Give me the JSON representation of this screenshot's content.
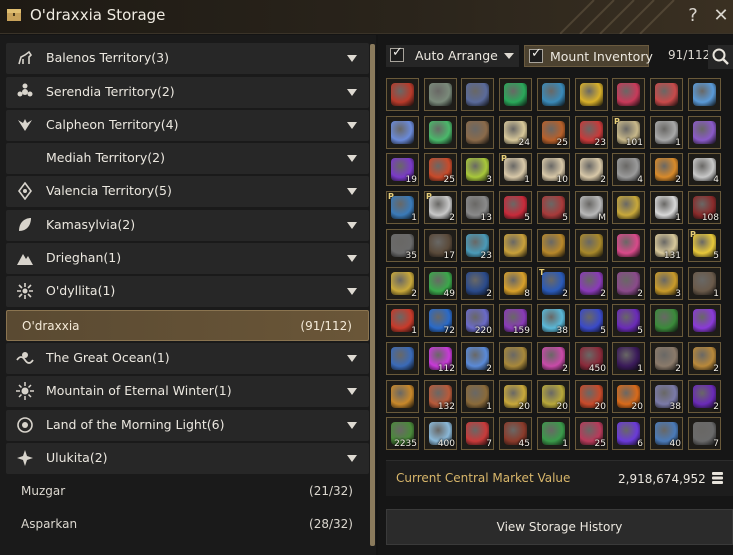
{
  "window": {
    "title": "O'draxxia Storage"
  },
  "regions": [
    {
      "label": "Balenos Territory(3)",
      "icon": "horse-icon"
    },
    {
      "label": "Serendia Territory(2)",
      "icon": "flower-icon"
    },
    {
      "label": "Calpheon Territory(4)",
      "icon": "wings-icon"
    },
    {
      "label": "Mediah Territory(2)",
      "icon": "crescent-icon"
    },
    {
      "label": "Valencia Territory(5)",
      "icon": "gem-icon"
    },
    {
      "label": "Kamasylvia(2)",
      "icon": "leaf-icon"
    },
    {
      "label": "Drieghan(1)",
      "icon": "mountain-icon"
    },
    {
      "label": "O'dyllita(1)",
      "icon": "blossom-icon"
    }
  ],
  "selected_storage": {
    "label": "O'draxxia",
    "count": "(91/112)"
  },
  "regions_after": [
    {
      "label": "The Great Ocean(1)",
      "icon": "wave-icon"
    },
    {
      "label": "Mountain of Eternal Winter(1)",
      "icon": "sun-icon"
    },
    {
      "label": "Land of the Morning Light(6)",
      "icon": "compass-icon"
    },
    {
      "label": "Ulukita(2)",
      "icon": "star-icon"
    }
  ],
  "ulukita_storages": [
    {
      "label": "Muzgar",
      "count": "(21/32)"
    },
    {
      "label": "Asparkan",
      "count": "(28/32)"
    }
  ],
  "controls": {
    "auto_arrange": "Auto Arrange",
    "mount_inventory": "Mount Inventory",
    "capacity": "91/112"
  },
  "items": [
    {
      "color": "#b83a2a",
      "qty": "",
      "pm": ""
    },
    {
      "color": "#7a8a7a",
      "qty": "",
      "pm": ""
    },
    {
      "color": "#5a6a9a",
      "qty": "",
      "pm": ""
    },
    {
      "color": "#2aa85a",
      "qty": "",
      "pm": ""
    },
    {
      "color": "#3a8ab8",
      "qty": "",
      "pm": ""
    },
    {
      "color": "#d8b02a",
      "qty": "",
      "pm": ""
    },
    {
      "color": "#c83a5a",
      "qty": "",
      "pm": ""
    },
    {
      "color": "#c84a4a",
      "qty": "",
      "pm": ""
    },
    {
      "color": "#5a9ad8",
      "qty": "",
      "pm": ""
    },
    {
      "color": "#6a8ad8",
      "qty": "",
      "pm": ""
    },
    {
      "color": "#4ab86a",
      "qty": "",
      "pm": ""
    },
    {
      "color": "#8a6a4a",
      "qty": "",
      "pm": ""
    },
    {
      "color": "#d8c89a",
      "qty": "24",
      "pm": ""
    },
    {
      "color": "#b8602a",
      "qty": "25",
      "pm": ""
    },
    {
      "color": "#c83a3a",
      "qty": "23",
      "pm": ""
    },
    {
      "color": "#c8b88a",
      "qty": "101",
      "pm": "P"
    },
    {
      "color": "#a8a8a8",
      "qty": "1",
      "pm": ""
    },
    {
      "color": "#8a5ac8",
      "qty": "",
      "pm": ""
    },
    {
      "color": "#7a3ac8",
      "qty": "19",
      "pm": ""
    },
    {
      "color": "#c84a2a",
      "qty": "25",
      "pm": ""
    },
    {
      "color": "#a8c83a",
      "qty": "3",
      "pm": ""
    },
    {
      "color": "#d8c8a8",
      "qty": "1",
      "pm": "P"
    },
    {
      "color": "#d8c8a8",
      "qty": "10",
      "pm": ""
    },
    {
      "color": "#d8c8a8",
      "qty": "2",
      "pm": ""
    },
    {
      "color": "#9a9a9a",
      "qty": "4",
      "pm": ""
    },
    {
      "color": "#d88a2a",
      "qty": "2",
      "pm": ""
    },
    {
      "color": "#c8c8c8",
      "qty": "4",
      "pm": ""
    },
    {
      "color": "#3a7ab8",
      "qty": "1",
      "pm": "P"
    },
    {
      "color": "#c8c8c8",
      "qty": "2",
      "pm": "P"
    },
    {
      "color": "#8a8a8a",
      "qty": "13",
      "pm": ""
    },
    {
      "color": "#c82a3a",
      "qty": "5",
      "pm": ""
    },
    {
      "color": "#a83a3a",
      "qty": "5",
      "pm": ""
    },
    {
      "color": "#b8b8b8",
      "qty": "M",
      "pm": ""
    },
    {
      "color": "#c8a83a",
      "qty": "",
      "pm": ""
    },
    {
      "color": "#d8d8d8",
      "qty": "1",
      "pm": ""
    },
    {
      "color": "#8a2a2a",
      "qty": "108",
      "pm": ""
    },
    {
      "color": "#6a6a6a",
      "qty": "35",
      "pm": ""
    },
    {
      "color": "#5a4a3a",
      "qty": "17",
      "pm": ""
    },
    {
      "color": "#4a9ab8",
      "qty": "23",
      "pm": ""
    },
    {
      "color": "#c8a03a",
      "qty": "",
      "pm": ""
    },
    {
      "color": "#b8882a",
      "qty": "",
      "pm": ""
    },
    {
      "color": "#a8882a",
      "qty": "",
      "pm": ""
    },
    {
      "color": "#d84a8a",
      "qty": "",
      "pm": ""
    },
    {
      "color": "#d8c89a",
      "qty": "131",
      "pm": ""
    },
    {
      "color": "#e8c83a",
      "qty": "5",
      "pm": "P"
    },
    {
      "color": "#c8a83a",
      "qty": "2",
      "pm": ""
    },
    {
      "color": "#3aa84a",
      "qty": "49",
      "pm": ""
    },
    {
      "color": "#2a4a8a",
      "qty": "2",
      "pm": ""
    },
    {
      "color": "#d8a02a",
      "qty": "8",
      "pm": ""
    },
    {
      "color": "#2a5ab8",
      "qty": "2",
      "pm": "T"
    },
    {
      "color": "#8a3ab8",
      "qty": "2",
      "pm": ""
    },
    {
      "color": "#8a4a8a",
      "qty": "2",
      "pm": ""
    },
    {
      "color": "#c89a2a",
      "qty": "3",
      "pm": ""
    },
    {
      "color": "#6a5a4a",
      "qty": "1",
      "pm": ""
    },
    {
      "color": "#c83a2a",
      "qty": "1",
      "pm": ""
    },
    {
      "color": "#2a6ac8",
      "qty": "72",
      "pm": ""
    },
    {
      "color": "#6a6ac8",
      "qty": "220",
      "pm": ""
    },
    {
      "color": "#8a3ab8",
      "qty": "159",
      "pm": ""
    },
    {
      "color": "#5ab8d8",
      "qty": "38",
      "pm": ""
    },
    {
      "color": "#3a4ac8",
      "qty": "5",
      "pm": ""
    },
    {
      "color": "#6a2ab8",
      "qty": "5",
      "pm": ""
    },
    {
      "color": "#3a8a3a",
      "qty": "",
      "pm": ""
    },
    {
      "color": "#8a3ad8",
      "qty": "",
      "pm": ""
    },
    {
      "color": "#3a6ab8",
      "qty": "",
      "pm": ""
    },
    {
      "color": "#c83ad8",
      "qty": "112",
      "pm": ""
    },
    {
      "color": "#5a8ad8",
      "qty": "2",
      "pm": ""
    },
    {
      "color": "#a8883a",
      "qty": "",
      "pm": ""
    },
    {
      "color": "#c84aa8",
      "qty": "2",
      "pm": ""
    },
    {
      "color": "#8a2a3a",
      "qty": "450",
      "pm": ""
    },
    {
      "color": "#3a1a5a",
      "qty": "1",
      "pm": ""
    },
    {
      "color": "#8a7a6a",
      "qty": "2",
      "pm": ""
    },
    {
      "color": "#b8883a",
      "qty": "2",
      "pm": ""
    },
    {
      "color": "#c8882a",
      "qty": "",
      "pm": ""
    },
    {
      "color": "#b85a3a",
      "qty": "132",
      "pm": ""
    },
    {
      "color": "#8a6a3a",
      "qty": "1",
      "pm": ""
    },
    {
      "color": "#c8a83a",
      "qty": "20",
      "pm": ""
    },
    {
      "color": "#b8a83a",
      "qty": "20",
      "pm": ""
    },
    {
      "color": "#c84a2a",
      "qty": "20",
      "pm": ""
    },
    {
      "color": "#d86a1a",
      "qty": "20",
      "pm": ""
    },
    {
      "color": "#7a7aa8",
      "qty": "38",
      "pm": ""
    },
    {
      "color": "#6a2ab8",
      "qty": "2",
      "pm": ""
    },
    {
      "color": "#4a8a3a",
      "qty": "2235",
      "pm": ""
    },
    {
      "color": "#8ab8d8",
      "qty": "400",
      "pm": ""
    },
    {
      "color": "#c83a3a",
      "qty": "7",
      "pm": ""
    },
    {
      "color": "#8a3a2a",
      "qty": "45",
      "pm": ""
    },
    {
      "color": "#3a9a4a",
      "qty": "1",
      "pm": ""
    },
    {
      "color": "#b83a5a",
      "qty": "25",
      "pm": ""
    },
    {
      "color": "#6a3ad8",
      "qty": "6",
      "pm": ""
    },
    {
      "color": "#4a7ab8",
      "qty": "40",
      "pm": ""
    },
    {
      "color": "#6a6a6a",
      "qty": "7",
      "pm": ""
    }
  ],
  "market": {
    "label": "Current Central Market Value",
    "value": "2,918,674,952"
  },
  "history_button": "View Storage History"
}
